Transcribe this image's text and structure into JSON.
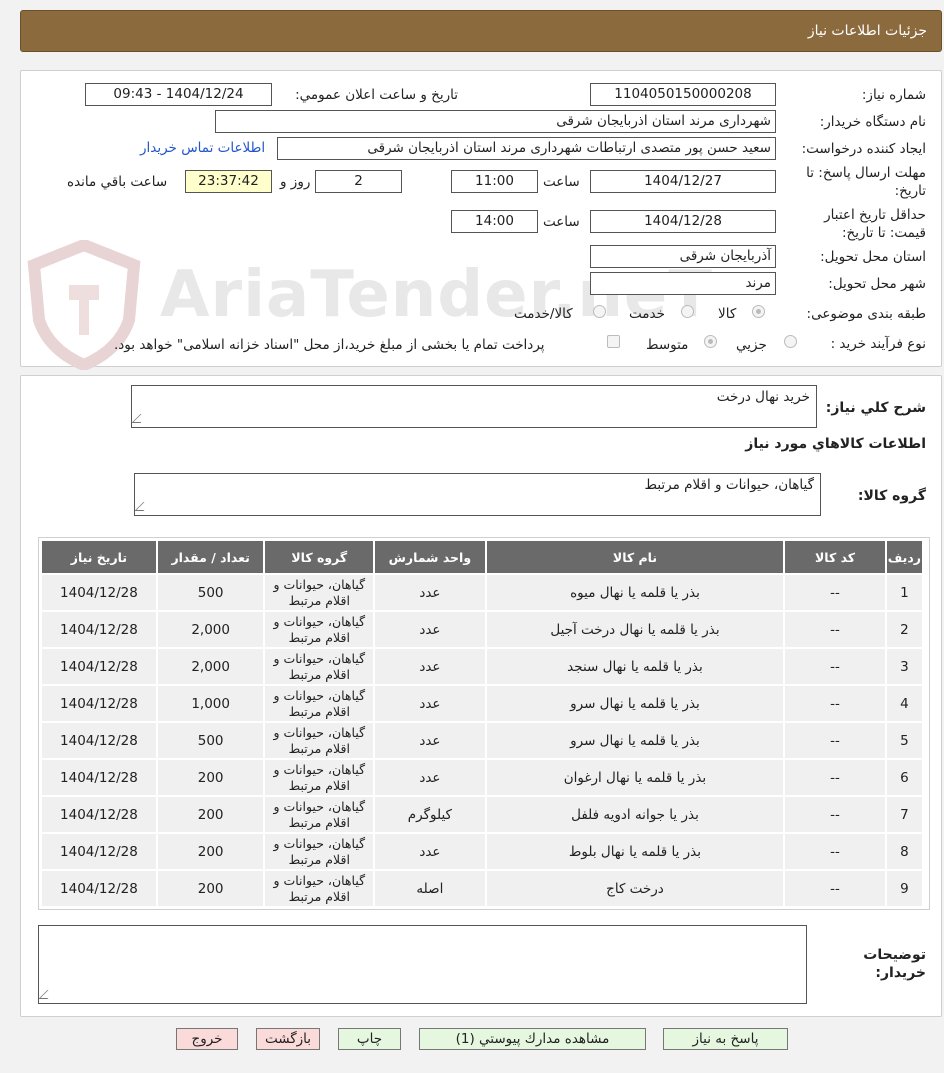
{
  "header": {
    "title": "جزئیات اطلاعات نیاز"
  },
  "info": {
    "need_number_label": "شماره نیاز:",
    "need_number": "1104050150000208",
    "announce_label": "تاریخ و ساعت اعلان عمومي:",
    "announce_value": "1404/12/24 - 09:43",
    "buyer_org_label": "نام دستگاه خريدار:",
    "buyer_org": "شهرداری مرند استان اذربایجان شرقی",
    "requester_label": "ايجاد کننده درخواست:",
    "requester": "سعید حسن پور متصدی ارتباطات شهرداری مرند استان اذربایجان شرقی",
    "contact_link": "اطلاعات تماس خريدار",
    "deadline_label": "مهلت ارسال پاسخ: تا تاریخ:",
    "deadline_date": "1404/12/27",
    "time_label": "ساعت",
    "deadline_time": "11:00",
    "days_value": "2",
    "days_label": "روز و",
    "countdown": "23:37:42",
    "remaining_label": "ساعت باقي مانده",
    "validity_label": "حداقل تاريخ اعتبار قيمت: تا تاريخ:",
    "validity_date": "1404/12/28",
    "validity_time": "14:00",
    "province_label": "استان محل تحويل:",
    "province": "آذربایجان شرقی",
    "city_label": "شهر محل تحويل:",
    "city": "مرند",
    "category_label": "طبقه بندی موضوعی:",
    "category_options": [
      "کالا",
      "خدمت",
      "کالا/خدمت"
    ],
    "purchase_type_label": "نوع فرآیند خرید :",
    "purchase_options": [
      "جزيي",
      "متوسط"
    ],
    "payment_note": "پرداخت تمام یا بخشی از مبلغ خرید،از محل \"اسناد خزانه اسلامی\" خواهد بود."
  },
  "summary": {
    "desc_label": "شرح کلي نياز:",
    "desc_value": "خرید نهال درخت",
    "goods_title": "اطلاعات کالاهاي مورد نياز",
    "group_label": "گروه کالا:",
    "group_value": "گیاهان، حیوانات و اقلام مرتبط"
  },
  "table": {
    "headers": [
      "رديف",
      "کد کالا",
      "نام کالا",
      "واحد شمارش",
      "گروه کالا",
      "تعداد / مقدار",
      "تاريخ نياز"
    ],
    "rows": [
      [
        "1",
        "--",
        "بذر یا قلمه یا نهال میوه",
        "عدد",
        "گیاهان، حیوانات و اقلام مرتبط",
        "500",
        "1404/12/28"
      ],
      [
        "2",
        "--",
        "بذر یا قلمه یا نهال درخت آجیل",
        "عدد",
        "گیاهان، حیوانات و اقلام مرتبط",
        "2,000",
        "1404/12/28"
      ],
      [
        "3",
        "--",
        "بذر یا قلمه یا نهال سنجد",
        "عدد",
        "گیاهان، حیوانات و اقلام مرتبط",
        "2,000",
        "1404/12/28"
      ],
      [
        "4",
        "--",
        "بذر یا قلمه یا نهال سرو",
        "عدد",
        "گیاهان، حیوانات و اقلام مرتبط",
        "1,000",
        "1404/12/28"
      ],
      [
        "5",
        "--",
        "بذر یا قلمه یا نهال سرو",
        "عدد",
        "گیاهان، حیوانات و اقلام مرتبط",
        "500",
        "1404/12/28"
      ],
      [
        "6",
        "--",
        "بذر یا قلمه یا نهال ارغوان",
        "عدد",
        "گیاهان، حیوانات و اقلام مرتبط",
        "200",
        "1404/12/28"
      ],
      [
        "7",
        "--",
        "بذر یا جوانه ادویه فلفل",
        "کیلوگرم",
        "گیاهان، حیوانات و اقلام مرتبط",
        "200",
        "1404/12/28"
      ],
      [
        "8",
        "--",
        "بذر یا قلمه یا نهال بلوط",
        "عدد",
        "گیاهان، حیوانات و اقلام مرتبط",
        "200",
        "1404/12/28"
      ],
      [
        "9",
        "--",
        "درخت کاج",
        "اصله",
        "گیاهان، حیوانات و اقلام مرتبط",
        "200",
        "1404/12/28"
      ]
    ]
  },
  "notes": {
    "label": "توضيحات خريدار:",
    "value": ""
  },
  "buttons": {
    "reply": "پاسخ به نياز",
    "attachments": "مشاهده مدارك پيوستي (1)",
    "print": "چاپ",
    "back": "بازگشت",
    "exit": "خروج"
  },
  "watermark": "AriaTender.neT"
}
